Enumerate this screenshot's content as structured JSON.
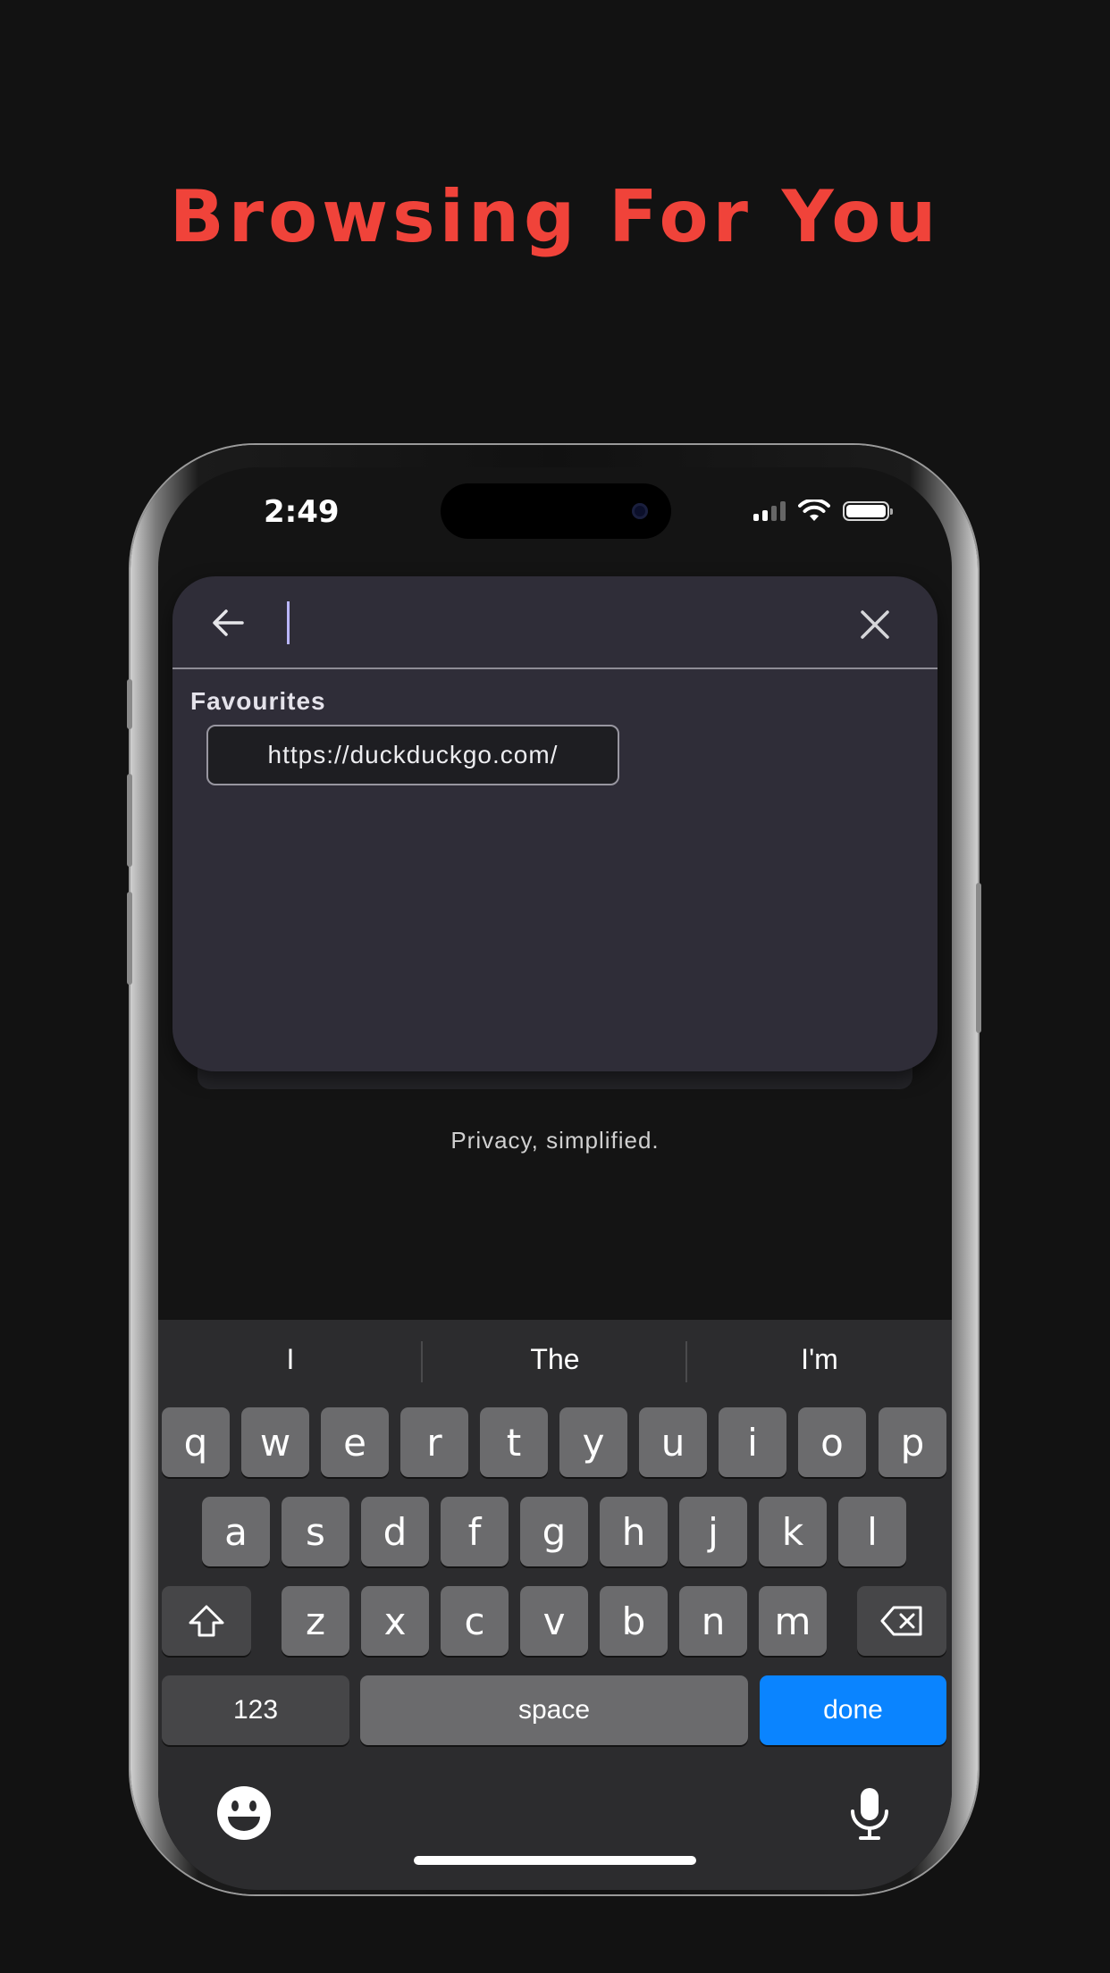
{
  "promo": {
    "headline": "Browsing For You"
  },
  "status_bar": {
    "time": "2:49"
  },
  "search": {
    "value": "",
    "placeholder": ""
  },
  "favourites": {
    "label": "Favourites",
    "items": [
      "https://duckduckgo.com/"
    ]
  },
  "tagline": "Privacy, simplified.",
  "keyboard": {
    "suggestions": [
      "I",
      "The",
      "I'm"
    ],
    "row1": [
      "q",
      "w",
      "e",
      "r",
      "t",
      "y",
      "u",
      "i",
      "o",
      "p"
    ],
    "row2": [
      "a",
      "s",
      "d",
      "f",
      "g",
      "h",
      "j",
      "k",
      "l"
    ],
    "row3": [
      "z",
      "x",
      "c",
      "v",
      "b",
      "n",
      "m"
    ],
    "numbers_label": "123",
    "space_label": "space",
    "done_label": "done"
  },
  "colors": {
    "headline": "#f0433a",
    "panel": "#2f2d38",
    "done_key": "#0a84ff",
    "background": "#121212"
  },
  "icons": {
    "back": "arrow-left-icon",
    "clear": "close-icon",
    "shift": "shift-icon",
    "delete": "backspace-icon",
    "emoji": "emoji-icon",
    "mic": "microphone-icon",
    "wifi": "wifi-icon",
    "signal": "cellular-signal-icon",
    "battery": "battery-icon"
  }
}
